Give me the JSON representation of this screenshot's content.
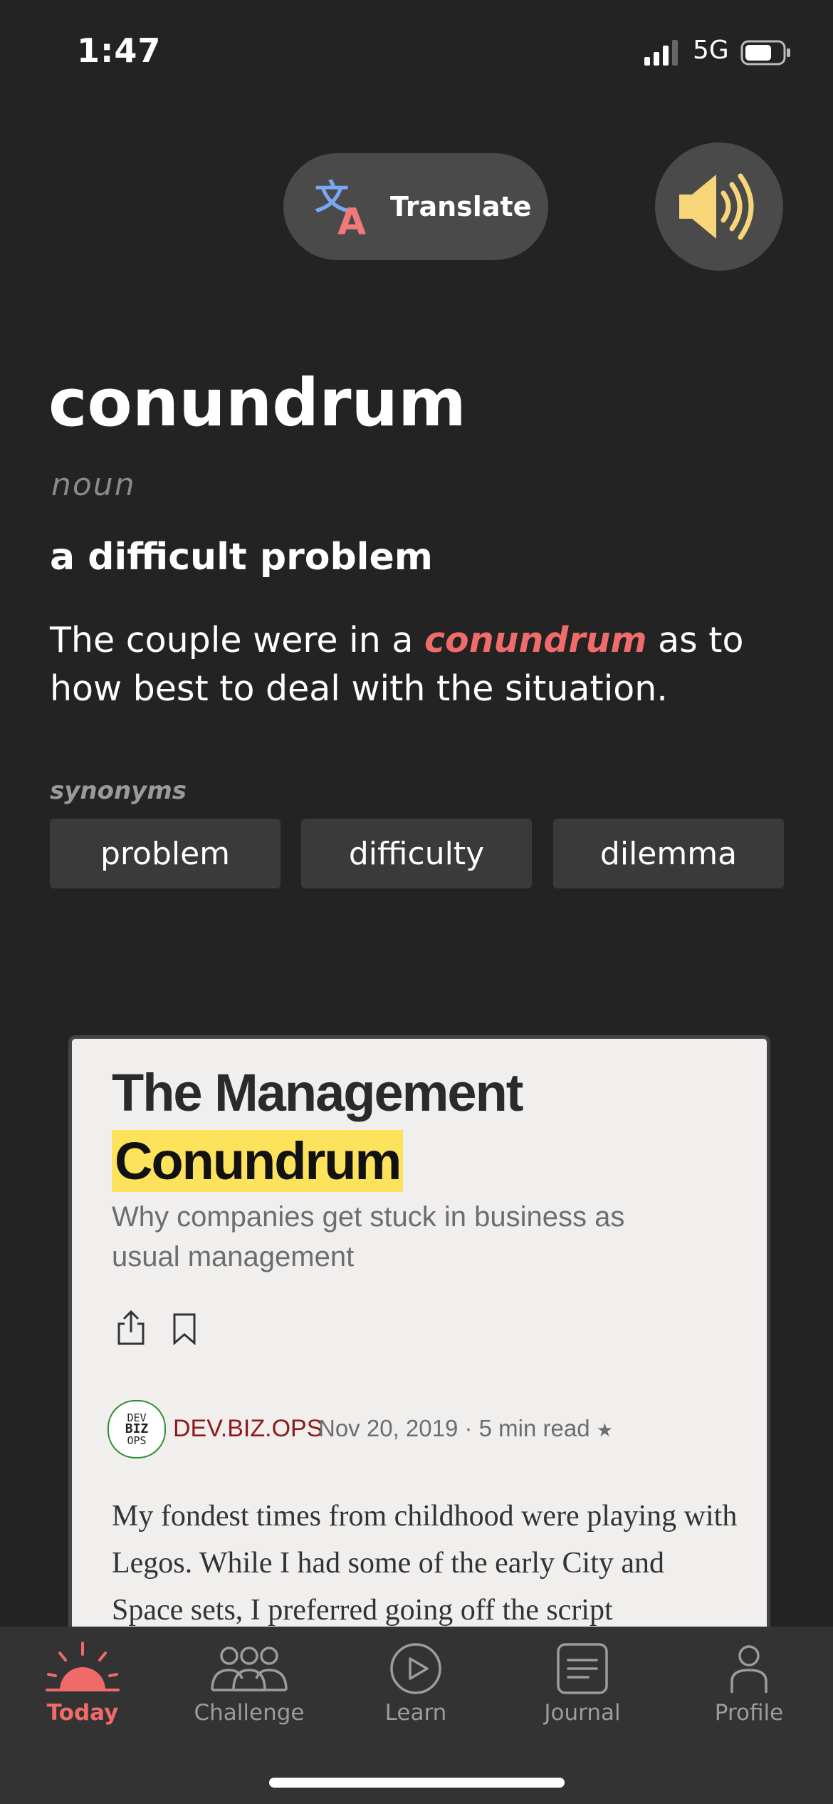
{
  "status_bar": {
    "time": "1:47",
    "network": "5G"
  },
  "toolbar": {
    "translate_label": "Translate"
  },
  "entry": {
    "word": "conundrum",
    "part_of_speech": "noun",
    "definition": "a difficult problem",
    "example_before": "The couple were in a ",
    "example_highlight": "conundrum",
    "example_after": " as to how best to deal with the situation.",
    "synonyms_label": "synonyms",
    "synonyms": [
      "problem",
      "difficulty",
      "dilemma"
    ]
  },
  "article": {
    "title_line1": "The Management",
    "title_highlight": "Conundrum",
    "subtitle": "Why companies get stuck in business as usual management",
    "avatar_text": [
      "DEV",
      "BIZ",
      "OPS"
    ],
    "author": "DEV.BIZ.OPS",
    "date": "Nov 20, 2019",
    "read_time": "5 min read",
    "body": "My fondest times from childhood were playing with Legos. While I had some of the early City and Space sets, I preferred going off the script"
  },
  "tabs": [
    {
      "label": "Today",
      "icon": "sun-icon",
      "active": true
    },
    {
      "label": "Challenge",
      "icon": "people-icon",
      "active": false
    },
    {
      "label": "Learn",
      "icon": "play-icon",
      "active": false
    },
    {
      "label": "Journal",
      "icon": "journal-icon",
      "active": false
    },
    {
      "label": "Profile",
      "icon": "profile-icon",
      "active": false
    }
  ],
  "colors": {
    "accent": "#f16a6a",
    "highlight": "#fde35c",
    "background": "#232323",
    "speaker": "#f7d67a"
  }
}
